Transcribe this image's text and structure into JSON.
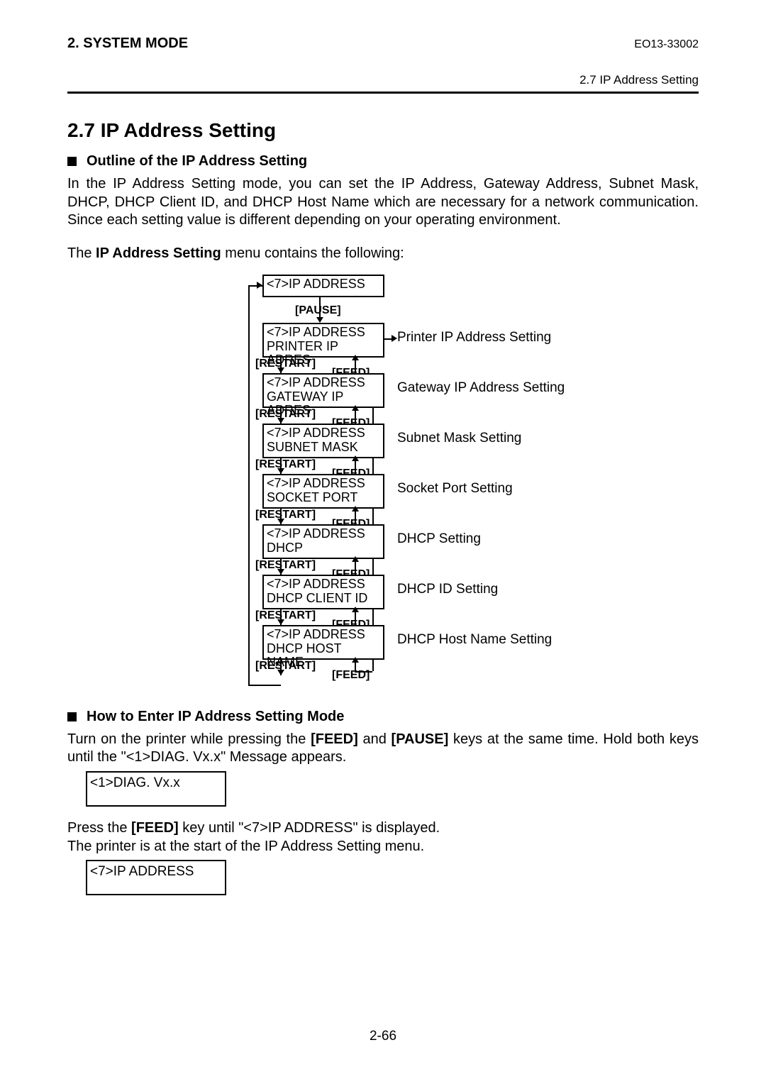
{
  "header": {
    "left": "2. SYSTEM MODE",
    "right": "EO13-33002",
    "sub": "2.7 IP Address Setting"
  },
  "section": {
    "title": "2.7  IP Address Setting",
    "outline_h": "Outline of the IP Address Setting",
    "outline_p": "In the IP Address Setting mode, you can set the IP Address, Gateway Address, Subnet Mask, DHCP, DHCP Client ID, and DHCP Host Name which are necessary for a network communication.  Since each setting value is different depending on your operating environment.",
    "menu_prefix": "The ",
    "menu_bold": "IP Address Setting",
    "menu_suffix": " menu contains the following:"
  },
  "flow": {
    "top": "<7>IP ADDRESS",
    "pause": "[PAUSE]",
    "restart": "[RESTART]",
    "feed": "[FEED]",
    "items": [
      {
        "l1": "<7>IP ADDRESS",
        "l2": "PRINTER IP ADRES",
        "desc": "Printer IP Address Setting"
      },
      {
        "l1": "<7>IP ADDRESS",
        "l2": "GATEWAY IP ADRES",
        "desc": "Gateway IP Address Setting"
      },
      {
        "l1": "<7>IP ADDRESS",
        "l2": "SUBNET MASK",
        "desc": "Subnet Mask Setting"
      },
      {
        "l1": "<7>IP ADDRESS",
        "l2": "SOCKET PORT",
        "desc": "Socket Port Setting"
      },
      {
        "l1": "<7>IP ADDRESS",
        "l2": "DHCP",
        "desc": "DHCP Setting"
      },
      {
        "l1": "<7>IP ADDRESS",
        "l2": "DHCP CLIENT ID",
        "desc": "DHCP ID Setting"
      },
      {
        "l1": "<7>IP ADDRESS",
        "l2": "DHCP HOST NAME",
        "desc": "DHCP Host Name Setting"
      }
    ]
  },
  "howto": {
    "h": "How to Enter IP Address Setting Mode",
    "p1a": "Turn on the printer while pressing the ",
    "p1b": "[FEED]",
    "p1c": " and ",
    "p1d": "[PAUSE]",
    "p1e": " keys at the same time.  Hold both keys until the \"<1>DIAG. Vx.x\" Message appears.",
    "screen1": "<1>DIAG.   Vx.x",
    "p2a": "Press the ",
    "p2b": "[FEED]",
    "p2c": " key until \"<7>IP ADDRESS\" is displayed.",
    "p2d": "The printer is at the start of the IP Address Setting menu.",
    "screen2": "<7>IP ADDRESS"
  },
  "pagenum": "2-66"
}
